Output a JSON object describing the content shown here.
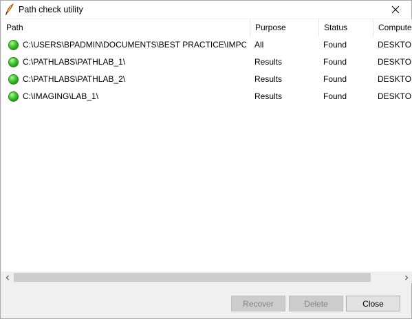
{
  "window": {
    "title": "Path check utility"
  },
  "columns": [
    "Path",
    "Purpose",
    "Status",
    "Computer"
  ],
  "rows": [
    {
      "path": "C:\\USERS\\BPADMIN\\DOCUMENTS\\BEST PRACTICE\\IMPORT\\",
      "purpose": "All",
      "status": "Found",
      "computer": "DESKTOP"
    },
    {
      "path": "C:\\PATHLABS\\PATHLAB_1\\",
      "purpose": "Results",
      "status": "Found",
      "computer": "DESKTOP"
    },
    {
      "path": "C:\\PATHLABS\\PATHLAB_2\\",
      "purpose": "Results",
      "status": "Found",
      "computer": "DESKTOP"
    },
    {
      "path": "C:\\IMAGING\\LAB_1\\",
      "purpose": "Results",
      "status": "Found",
      "computer": "DESKTOP"
    }
  ],
  "buttons": {
    "recover": "Recover",
    "delete": "Delete",
    "close": "Close"
  },
  "colors": {
    "status_found": "#2fb81f",
    "disabled_button_bg": "#cccccc",
    "scroll_thumb": "#cdcdcd"
  },
  "icons": {
    "app": "feather-pen-icon",
    "status": "green-circle-icon",
    "close": "close-icon",
    "scroll_left": "chevron-left-icon",
    "scroll_right": "chevron-right-icon"
  }
}
